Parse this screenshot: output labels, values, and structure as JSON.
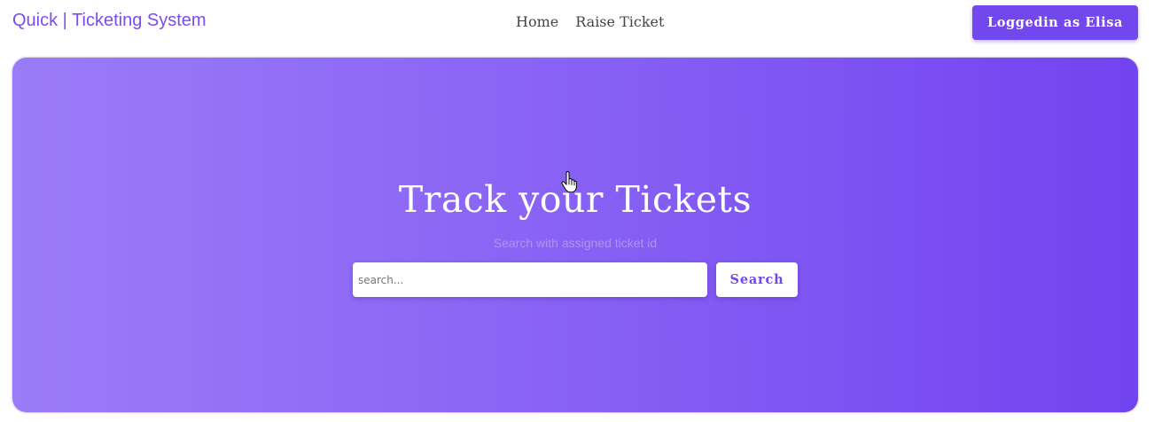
{
  "header": {
    "brand": "Quick | Ticketing System",
    "nav": [
      {
        "label": "Home"
      },
      {
        "label": "Raise Ticket"
      }
    ],
    "user_button_label": "Loggedin as Elisa"
  },
  "hero": {
    "title": "Track your Tickets",
    "subtitle": "Search with assigned ticket id",
    "search": {
      "placeholder": "search...",
      "value": "",
      "button_label": "Search"
    }
  },
  "colors": {
    "accent": "#7347ee",
    "gradient_start": "#9b7cf7",
    "gradient_end": "#7243f0"
  },
  "icons": {
    "cursor": "hand-pointer-icon"
  }
}
